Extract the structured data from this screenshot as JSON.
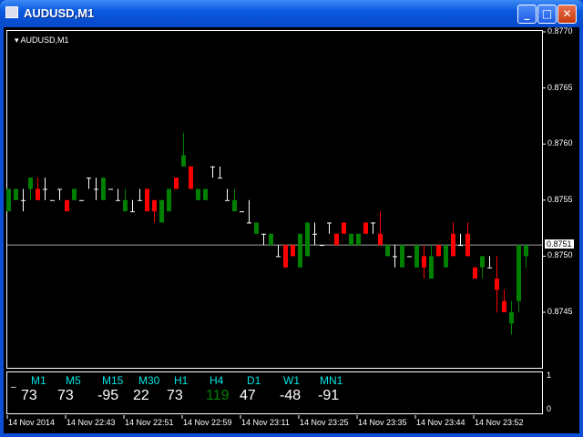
{
  "window": {
    "title": "AUDUSD,M1",
    "minimize": "_",
    "maximize": "□",
    "close": "✕"
  },
  "chart": {
    "symbol_label": "AUDUSD,M1",
    "bid_price": "0.8751",
    "price_labels": [
      "0.8770",
      "0.8765",
      "0.8760",
      "0.8755",
      "0.8750",
      "0.8745"
    ],
    "price_values": [
      0.877,
      0.8765,
      0.876,
      0.8755,
      0.875,
      0.8745
    ],
    "time_labels": [
      "14 Nov 2014",
      "14 Nov 22:43",
      "14 Nov 22:51",
      "14 Nov 22:59",
      "14 Nov 23:11",
      "14 Nov 23:25",
      "14 Nov 23:35",
      "14 Nov 23:44",
      "14 Nov 23:52"
    ],
    "colors": {
      "bull": "#008000",
      "bear": "#ff0000",
      "doji": "#ffffff",
      "bid_line": "#a0a0a0"
    }
  },
  "chart_data": {
    "type": "candlestick",
    "ylim": [
      0.87405,
      0.877
    ],
    "ohlc": [
      [
        0.8754,
        0.8756,
        0.8754,
        0.8756
      ],
      [
        0.8755,
        0.8756,
        0.8755,
        0.8756
      ],
      [
        0.8755,
        0.8756,
        0.8754,
        0.8755
      ],
      [
        0.8756,
        0.8757,
        0.8755,
        0.8757
      ],
      [
        0.8756,
        0.8757,
        0.8755,
        0.8755
      ],
      [
        0.8756,
        0.8757,
        0.8755,
        0.8756
      ],
      [
        0.8755,
        0.8755,
        0.8755,
        0.8755
      ],
      [
        0.8756,
        0.8756,
        0.8755,
        0.8756
      ],
      [
        0.8755,
        0.8755,
        0.8754,
        0.8754
      ],
      [
        0.8755,
        0.8756,
        0.8755,
        0.8756
      ],
      [
        0.8755,
        0.8755,
        0.8755,
        0.8755
      ],
      [
        0.8757,
        0.8757,
        0.8756,
        0.8757
      ],
      [
        0.8756,
        0.8757,
        0.8755,
        0.8756
      ],
      [
        0.8755,
        0.8757,
        0.8755,
        0.8757
      ],
      [
        0.8756,
        0.8756,
        0.8756,
        0.8756
      ],
      [
        0.8755,
        0.8756,
        0.8755,
        0.8755
      ],
      [
        0.8754,
        0.8756,
        0.8754,
        0.8755
      ],
      [
        0.8754,
        0.8755,
        0.8754,
        0.8754
      ],
      [
        0.8755,
        0.8756,
        0.8755,
        0.8755
      ],
      [
        0.8756,
        0.8756,
        0.8754,
        0.8754
      ],
      [
        0.8755,
        0.8755,
        0.8753,
        0.8754
      ],
      [
        0.8753,
        0.8755,
        0.8753,
        0.8755
      ],
      [
        0.8754,
        0.8756,
        0.8754,
        0.8756
      ],
      [
        0.8757,
        0.8757,
        0.8756,
        0.8756
      ],
      [
        0.8758,
        0.8761,
        0.8758,
        0.8759
      ],
      [
        0.8758,
        0.8758,
        0.8756,
        0.8756
      ],
      [
        0.8755,
        0.8756,
        0.8755,
        0.8756
      ],
      [
        0.8755,
        0.8756,
        0.8755,
        0.8756
      ],
      [
        0.8758,
        0.8758,
        0.8757,
        0.8758
      ],
      [
        0.8757,
        0.8758,
        0.8757,
        0.8757
      ],
      [
        0.8755,
        0.8756,
        0.8755,
        0.8755
      ],
      [
        0.8754,
        0.8756,
        0.8754,
        0.8755
      ],
      [
        0.8754,
        0.8754,
        0.8754,
        0.8754
      ],
      [
        0.8753,
        0.8755,
        0.8753,
        0.8753
      ],
      [
        0.8752,
        0.8753,
        0.8752,
        0.8753
      ],
      [
        0.8752,
        0.8752,
        0.8751,
        0.8752
      ],
      [
        0.8751,
        0.8752,
        0.8751,
        0.8752
      ],
      [
        0.875,
        0.8751,
        0.875,
        0.875
      ],
      [
        0.8751,
        0.8751,
        0.8749,
        0.8749
      ],
      [
        0.8751,
        0.8751,
        0.875,
        0.875
      ],
      [
        0.8749,
        0.8752,
        0.8749,
        0.8752
      ],
      [
        0.875,
        0.8753,
        0.875,
        0.8753
      ],
      [
        0.8752,
        0.8753,
        0.8751,
        0.8752
      ],
      [
        0.8751,
        0.8751,
        0.8751,
        0.8751
      ],
      [
        0.8753,
        0.8753,
        0.8752,
        0.8753
      ],
      [
        0.8752,
        0.8752,
        0.8751,
        0.8751
      ],
      [
        0.8753,
        0.8753,
        0.8752,
        0.8752
      ],
      [
        0.8751,
        0.8752,
        0.8751,
        0.8752
      ],
      [
        0.8751,
        0.8752,
        0.8751,
        0.8752
      ],
      [
        0.8753,
        0.8753,
        0.8752,
        0.8752
      ],
      [
        0.8753,
        0.8753,
        0.8752,
        0.8753
      ],
      [
        0.8752,
        0.8754,
        0.8751,
        0.8751
      ],
      [
        0.875,
        0.8751,
        0.875,
        0.8751
      ],
      [
        0.875,
        0.8751,
        0.8749,
        0.875
      ],
      [
        0.8749,
        0.8751,
        0.8749,
        0.8751
      ],
      [
        0.875,
        0.875,
        0.875,
        0.875
      ],
      [
        0.8749,
        0.8751,
        0.8749,
        0.8751
      ],
      [
        0.875,
        0.8751,
        0.8748,
        0.8749
      ],
      [
        0.8748,
        0.8751,
        0.8748,
        0.875
      ],
      [
        0.8751,
        0.8751,
        0.875,
        0.875
      ],
      [
        0.8749,
        0.8751,
        0.8749,
        0.8751
      ],
      [
        0.8752,
        0.8753,
        0.875,
        0.875
      ],
      [
        0.8751,
        0.8752,
        0.8751,
        0.8751
      ],
      [
        0.8752,
        0.8753,
        0.875,
        0.875
      ],
      [
        0.8749,
        0.8749,
        0.8748,
        0.8748
      ],
      [
        0.8749,
        0.875,
        0.8748,
        0.875
      ],
      [
        0.8749,
        0.875,
        0.8749,
        0.8749
      ],
      [
        0.8748,
        0.875,
        0.8745,
        0.8747
      ],
      [
        0.8746,
        0.8747,
        0.8745,
        0.8745
      ],
      [
        0.8744,
        0.8746,
        0.8743,
        0.8745
      ],
      [
        0.8746,
        0.8751,
        0.8745,
        0.8751
      ],
      [
        0.875,
        0.8751,
        0.8749,
        0.8751
      ]
    ]
  },
  "indicator": {
    "prefix": "_",
    "scale_max": "1",
    "scale_min": "0",
    "timeframes": [
      {
        "label": "M1",
        "value": "73",
        "color": "#ffffff"
      },
      {
        "label": "M5",
        "value": "73",
        "color": "#ffffff"
      },
      {
        "label": "M15",
        "value": "-95",
        "color": "#ffffff"
      },
      {
        "label": "M30",
        "value": "22",
        "color": "#ffffff"
      },
      {
        "label": "H1",
        "value": "73",
        "color": "#ffffff"
      },
      {
        "label": "H4",
        "value": "119",
        "color": "#008000"
      },
      {
        "label": "D1",
        "value": "47",
        "color": "#ffffff"
      },
      {
        "label": "W1",
        "value": "-48",
        "color": "#ffffff"
      },
      {
        "label": "MN1",
        "value": "-91",
        "color": "#ffffff"
      }
    ]
  }
}
